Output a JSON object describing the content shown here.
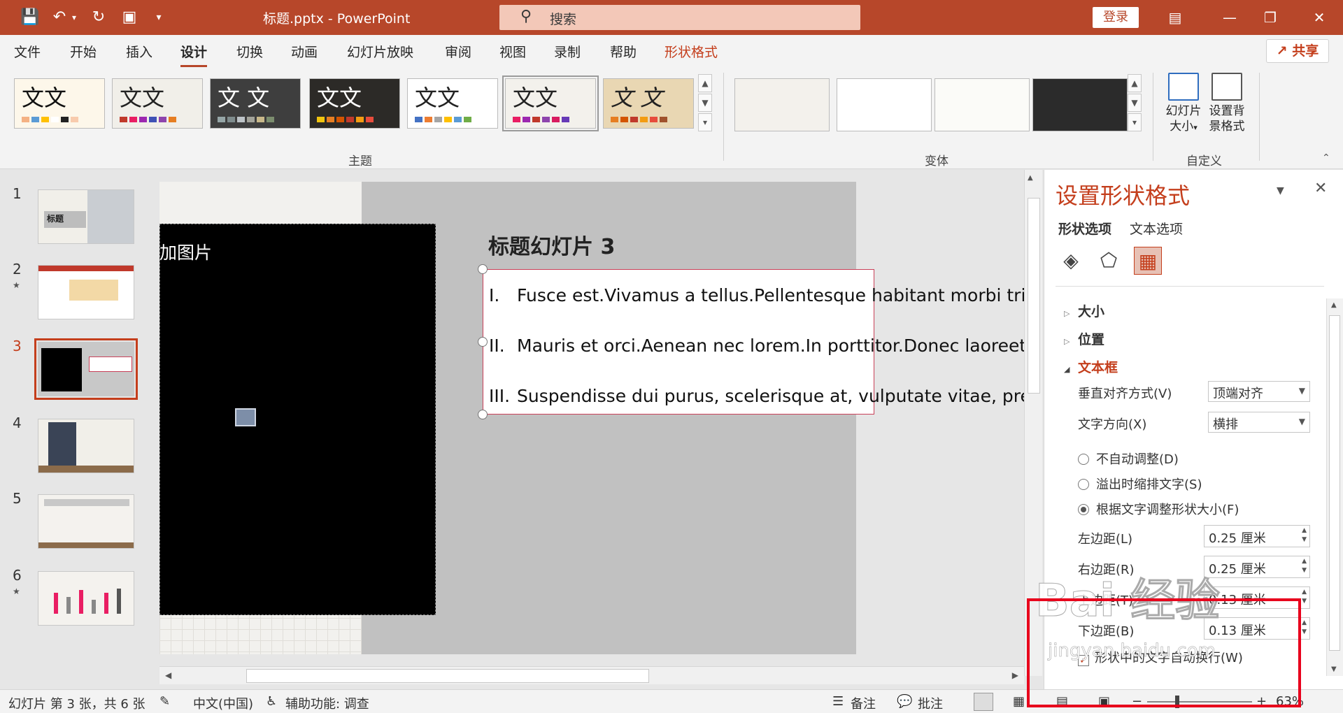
{
  "window": {
    "doc_title": "标题.pptx  -  PowerPoint",
    "search_label": "搜索",
    "login_label": "登录"
  },
  "tabs": [
    "文件",
    "开始",
    "插入",
    "设计",
    "切换",
    "动画",
    "幻灯片放映",
    "审阅",
    "视图",
    "录制",
    "帮助",
    "形状格式"
  ],
  "active_tab": "设计",
  "share_label": "共享",
  "ribbon": {
    "themes_label": "主题",
    "theme_text": "文文",
    "theme_text_alt": "文 文",
    "variants_label": "变体",
    "custom_label": "自定义",
    "slide_size_label_1": "幻灯片",
    "slide_size_label_2": "大小",
    "bg_format_label_1": "设置背",
    "bg_format_label_2": "景格式"
  },
  "slides_panel": {
    "numbers": [
      "1",
      "2",
      "3",
      "4",
      "5",
      "6"
    ],
    "active": "3",
    "thumb1_title": "标题"
  },
  "slide": {
    "pic_label": "加图片",
    "title": "标题幻灯片 3",
    "bullets": [
      {
        "num": "I.",
        "text": "Fusce est.Vivamus a tellus.Pellentesque habitant morbi tristiq"
      },
      {
        "num": "II.",
        "text": "Mauris et orci.Aenean nec lorem.In porttitor.Donec laoreet no"
      },
      {
        "num": "III.",
        "text": "Suspendisse dui purus, scelerisque at, vulputate vitae, pretiur"
      }
    ]
  },
  "format_pane": {
    "title": "设置形状格式",
    "tab_shape": "形状选项",
    "tab_text": "文本选项",
    "section_size": "大小",
    "section_position": "位置",
    "section_textbox": "文本框",
    "valign_label": "垂直对齐方式(V)",
    "valign_value": "顶端对齐",
    "direction_label": "文字方向(X)",
    "direction_value": "横排",
    "radio_no_autofit": "不自动调整(D)",
    "radio_shrink": "溢出时缩排文字(S)",
    "radio_resize": "根据文字调整形状大小(F)",
    "left_margin_label": "左边距(L)",
    "left_margin_value": "0.25 厘米",
    "right_margin_label": "右边距(R)",
    "right_margin_value": "0.25 厘米",
    "top_margin_label": "上边距(T)",
    "top_margin_value": "0.13 厘米",
    "bottom_margin_label": "下边距(B)",
    "bottom_margin_value": "0.13 厘米",
    "wrap_label": "形状中的文字自动换行(W)"
  },
  "status": {
    "slide_info": "幻灯片 第 3 张，共 6 张",
    "language": "中文(中国)",
    "accessibility": "辅助功能: 调查",
    "notes": "备注",
    "comments": "批注",
    "zoom": "63%"
  },
  "watermark": {
    "logo": "Bai 经验",
    "url": "jingyan.baidu.com"
  },
  "colors": {
    "brand": "#b7472a",
    "accent": "#c43e1c",
    "annotation": "#e8001c"
  }
}
